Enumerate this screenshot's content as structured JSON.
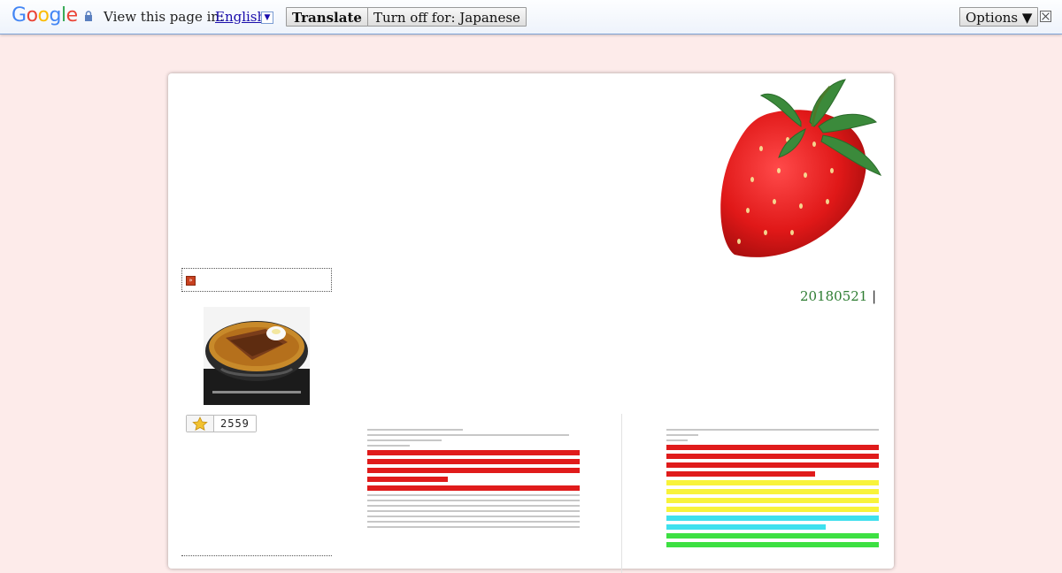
{
  "translate_bar": {
    "logo": "Google",
    "view_label": "View this page in:",
    "language": "English",
    "translate_button": "Translate",
    "turn_off_button": "Turn off for: Japanese",
    "options_button": "Options ▼"
  },
  "sidebar": {
    "hit_count": "2559"
  },
  "post": {
    "date": "20180521",
    "separator": "|"
  },
  "colors": {
    "page_bg": "#fdebea",
    "date_text": "#2e7d32",
    "highlight_red": "#e01b1b",
    "highlight_yellow": "#f8f33a",
    "highlight_cyan": "#3fe0ee",
    "highlight_green": "#3de042"
  }
}
